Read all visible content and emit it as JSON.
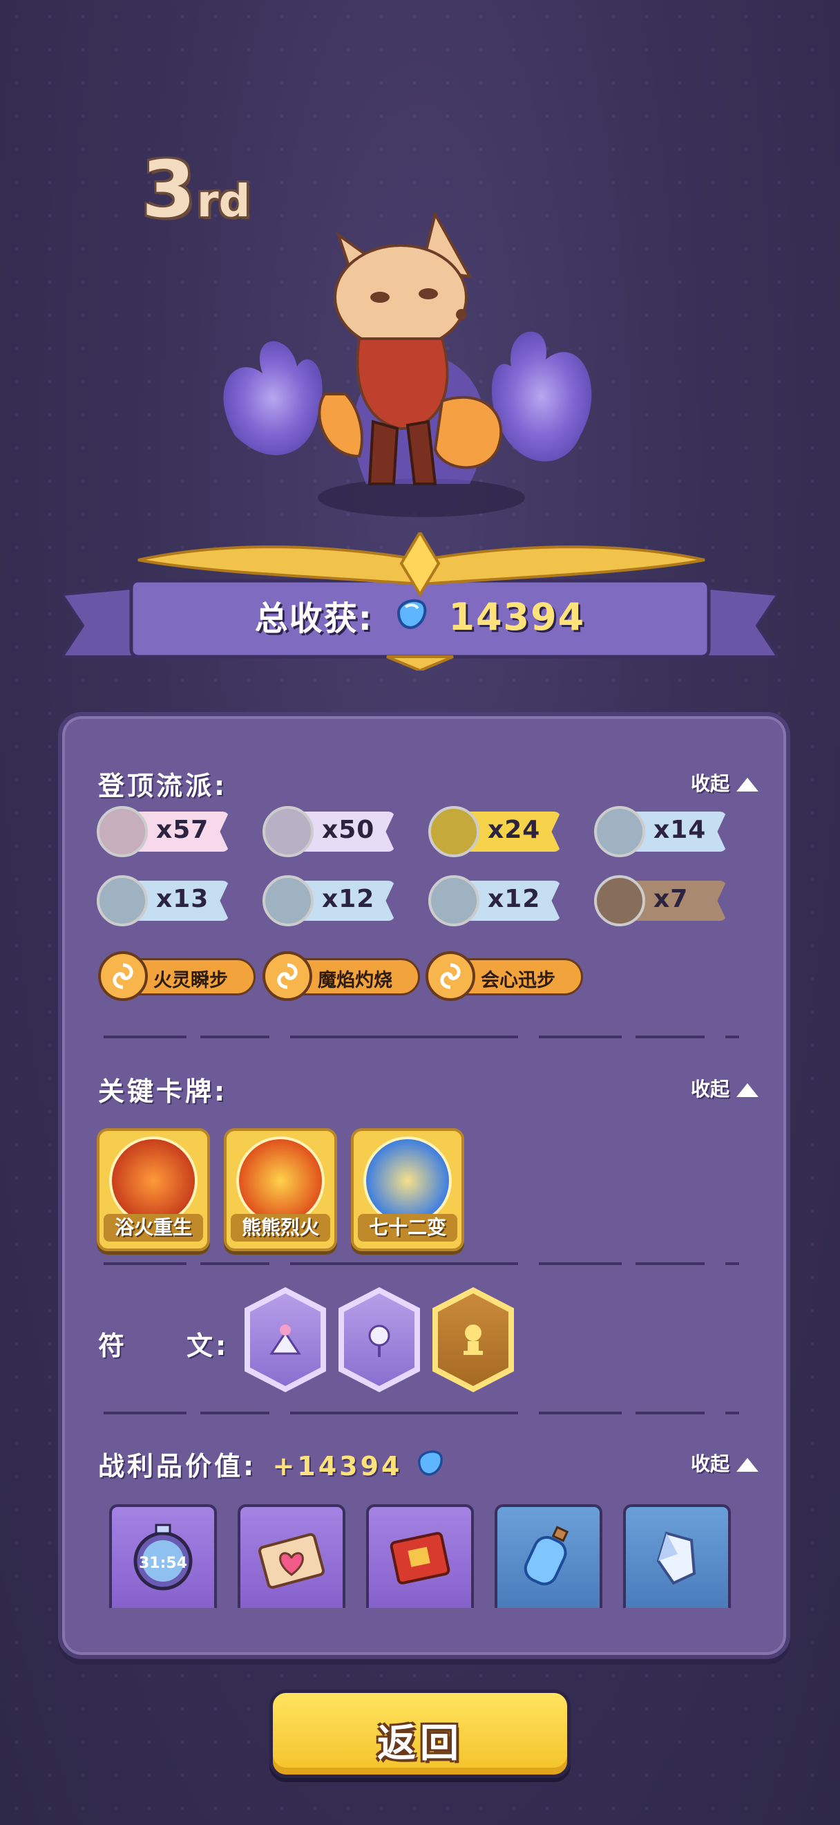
{
  "header": {
    "rank_number": "3",
    "rank_suffix": "rd",
    "total_label": "总收获:",
    "total_value": "14394"
  },
  "sections": {
    "schools": {
      "title": "登顶流派:",
      "collapse_label": "收起",
      "tags": [
        {
          "count": "x57",
          "icon": "fire-swirl-icon",
          "color": "#f7d9ec"
        },
        {
          "count": "x50",
          "icon": "boot-icon",
          "color": "#e6dcf5"
        },
        {
          "count": "x24",
          "icon": "burst-icon",
          "color": "#f6d34a"
        },
        {
          "count": "x14",
          "icon": "plus-icon",
          "color": "#c6def2"
        },
        {
          "count": "x13",
          "icon": "claw-icon",
          "color": "#c6def2"
        },
        {
          "count": "x12",
          "icon": "snowflake-icon",
          "color": "#c6def2"
        },
        {
          "count": "x12",
          "icon": "sword-icon",
          "color": "#c6def2"
        },
        {
          "count": "x7",
          "icon": "potion-icon",
          "color": "#a98a70"
        }
      ],
      "styles": [
        {
          "label": "火灵瞬步"
        },
        {
          "label": "魔焰灼烧"
        },
        {
          "label": "会心迅步"
        }
      ]
    },
    "cards": {
      "title": "关键卡牌:",
      "collapse_label": "收起",
      "items": [
        {
          "label": "浴火重生"
        },
        {
          "label": "熊熊烈火"
        },
        {
          "label": "七十二变"
        }
      ]
    },
    "runes": {
      "title_a": "符",
      "title_b": "文:"
    },
    "loot": {
      "title": "战利品价值:",
      "value": "+14394",
      "collapse_label": "收起",
      "items": [
        {
          "icon": "stopwatch-icon",
          "text": "31:54"
        },
        {
          "icon": "envelope-heart-icon"
        },
        {
          "icon": "red-book-icon"
        },
        {
          "icon": "potion-bottle-icon"
        },
        {
          "icon": "crystal-icon"
        }
      ]
    }
  },
  "footer": {
    "back_label": "返回"
  }
}
